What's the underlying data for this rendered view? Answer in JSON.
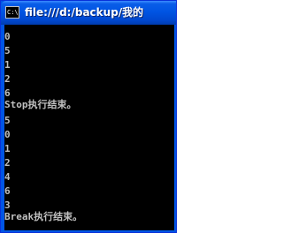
{
  "window": {
    "title": "file:///d:/backup/我的",
    "icon": "console-window-icon",
    "icon_text": "C:\\"
  },
  "console": {
    "lines": [
      "0",
      "5",
      "1",
      "2",
      "6",
      "Stop执行结束。",
      "5",
      "0",
      "1",
      "2",
      "4",
      "6",
      "3",
      "Break执行结束。"
    ]
  }
}
